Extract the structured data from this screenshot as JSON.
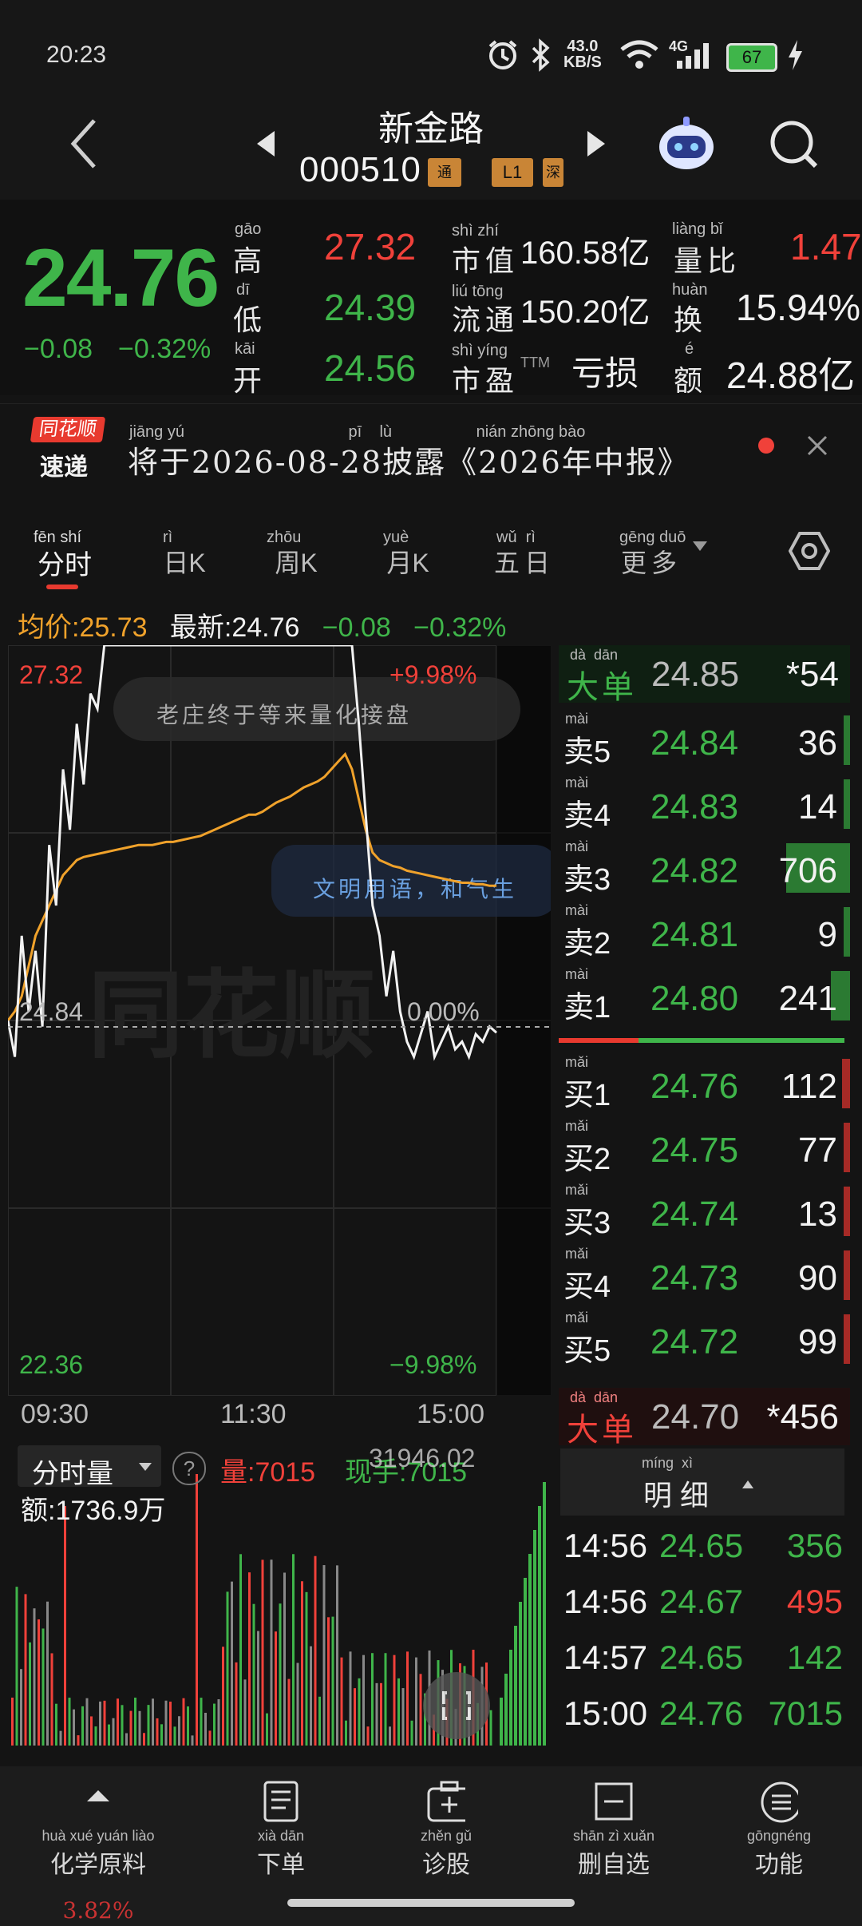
{
  "status_bar": {
    "time": "20:23",
    "network_speed": "43.0\nKB/S",
    "signal": "4G",
    "battery": "67"
  },
  "header": {
    "name": "新金路",
    "code": "000510",
    "tag_tong": "通",
    "tag_level": "L1",
    "tag_sz": "深"
  },
  "quote": {
    "price": "24.76",
    "change": "−0.08",
    "change_pct": "−0.32%",
    "high_label": "高",
    "high": "27.32",
    "low_label": "低",
    "low": "24.39",
    "open_label": "开",
    "open": "24.56",
    "mktcap_label": "市值",
    "mktcap": "160.58亿",
    "float_label": "流通",
    "float_cap": "150.20亿",
    "pe_label": "市盈",
    "pe_suffix": "TTM",
    "pe": "亏损",
    "vol_ratio_label": "量比",
    "vol_ratio": "1.47",
    "turnover_label": "换",
    "turnover": "15.94%",
    "amount_label": "额",
    "amount": "24.88亿"
  },
  "news": {
    "logo_top": "同花顺",
    "logo_bottom": "速递",
    "text": "将于2026-08-28披露《2026年中报》"
  },
  "tabs": [
    "分时",
    "日K",
    "周K",
    "月K",
    "五日",
    "更多"
  ],
  "avg_bar": {
    "avg": "均价:25.73",
    "latest": "最新:24.76",
    "change": "−0.08",
    "pct": "−0.32%"
  },
  "chart_data": {
    "type": "line",
    "y_max_label": "27.32",
    "y_min_label": "22.36",
    "y_mid_label": "24.84",
    "pct_max_label": "+9.98%",
    "pct_min_label": "−9.98%",
    "pct_mid_label": "0.00%",
    "time_labels": [
      "09:30",
      "11:30",
      "15:00"
    ],
    "ylim": [
      22.36,
      27.32
    ],
    "series": [
      {
        "name": "最新",
        "color": "#f2f2f2",
        "values": [
          24.84,
          24.6,
          25.4,
          24.9,
          25.3,
          24.8,
          26.0,
          25.6,
          26.5,
          26.1,
          26.8,
          26.4,
          27.0,
          26.9,
          27.32,
          27.32,
          27.32,
          27.32,
          27.32,
          27.32,
          27.32,
          27.32,
          27.32,
          27.32,
          27.32,
          27.32,
          27.32,
          27.32,
          27.32,
          27.32,
          27.32,
          27.32,
          27.32,
          27.32,
          27.32,
          27.32,
          27.32,
          27.32,
          27.32,
          27.32,
          27.32,
          27.32,
          27.32,
          27.32,
          27.32,
          27.32,
          27.32,
          27.32,
          27.32,
          27.32,
          27.32,
          26.8,
          26.2,
          25.6,
          25.4,
          25.0,
          25.3,
          24.9,
          24.7,
          24.6,
          24.75,
          24.9,
          24.6,
          24.7,
          24.8,
          24.65,
          24.7,
          24.6,
          24.75,
          24.7,
          24.8,
          24.76
        ]
      },
      {
        "name": "均价",
        "color": "#f0a22b",
        "values": [
          24.84,
          24.9,
          25.0,
          25.2,
          25.4,
          25.5,
          25.6,
          25.7,
          25.8,
          25.85,
          25.9,
          25.92,
          25.93,
          25.94,
          25.95,
          25.96,
          25.97,
          25.98,
          25.99,
          26.0,
          26.0,
          26.0,
          26.01,
          26.02,
          26.02,
          26.03,
          26.04,
          26.05,
          26.06,
          26.08,
          26.1,
          26.12,
          26.14,
          26.16,
          26.18,
          26.2,
          26.2,
          26.22,
          26.25,
          26.28,
          26.3,
          26.32,
          26.35,
          26.38,
          26.4,
          26.42,
          26.45,
          26.5,
          26.55,
          26.6,
          26.5,
          26.3,
          26.1,
          25.95,
          25.9,
          25.88,
          25.86,
          25.85,
          25.83,
          25.82,
          25.81,
          25.8,
          25.79,
          25.78,
          25.77,
          25.76,
          25.75,
          25.75,
          25.74,
          25.74,
          25.73,
          25.73
        ]
      }
    ]
  },
  "watermark": "同花顺",
  "chart_notes": {
    "bubble1": "老庄终于等来量化接盘",
    "bubble2": "文明用语，和气生"
  },
  "volume": {
    "selector": "分时量",
    "help": "?",
    "vol": "量:7015",
    "now": "现手:7015",
    "extra": "31946.02",
    "amount": "额:1736.9万"
  },
  "order_book": {
    "big_sell": {
      "label": "大单",
      "price": "24.85",
      "vol": "*54"
    },
    "asks": [
      {
        "label": "卖5",
        "price": "24.84",
        "vol": "36",
        "bar": 0.02
      },
      {
        "label": "卖4",
        "price": "24.83",
        "vol": "14",
        "bar": 0.01
      },
      {
        "label": "卖3",
        "price": "24.82",
        "vol": "706",
        "bar": 0.5
      },
      {
        "label": "卖2",
        "price": "24.81",
        "vol": "9",
        "bar": 0.01
      },
      {
        "label": "卖1",
        "price": "24.80",
        "vol": "241",
        "bar": 0.15
      }
    ],
    "bids": [
      {
        "label": "买1",
        "price": "24.76",
        "vol": "112",
        "bar": 0.06
      },
      {
        "label": "买2",
        "price": "24.75",
        "vol": "77",
        "bar": 0.04
      },
      {
        "label": "买3",
        "price": "24.74",
        "vol": "13",
        "bar": 0.01
      },
      {
        "label": "买4",
        "price": "24.73",
        "vol": "90",
        "bar": 0.05
      },
      {
        "label": "买5",
        "price": "24.72",
        "vol": "99",
        "bar": 0.05
      }
    ],
    "big_buy": {
      "label": "大单",
      "price": "24.70",
      "vol": "*456"
    }
  },
  "detail": {
    "title": "明细",
    "ticks": [
      {
        "time": "14:56",
        "price": "24.65",
        "vol": "356",
        "side": "sell"
      },
      {
        "time": "14:56",
        "price": "24.67",
        "vol": "495",
        "side": "buy"
      },
      {
        "time": "14:57",
        "price": "24.65",
        "vol": "142",
        "side": "sell"
      },
      {
        "time": "15:00",
        "price": "24.76",
        "vol": "7015",
        "side": "sell"
      }
    ]
  },
  "bottom_nav": [
    {
      "label": "化学原料",
      "sub": "3.82%",
      "icon": "up-arrow-icon"
    },
    {
      "label": "下单",
      "icon": "order-icon"
    },
    {
      "label": "诊股",
      "icon": "diagnose-icon"
    },
    {
      "label": "删自选",
      "icon": "remove-watchlist-icon"
    },
    {
      "label": "功能",
      "icon": "menu-icon"
    }
  ],
  "colors": {
    "up": "#f0413a",
    "down": "#3fb54a",
    "avg": "#f0a22b",
    "bg": "#141414"
  }
}
